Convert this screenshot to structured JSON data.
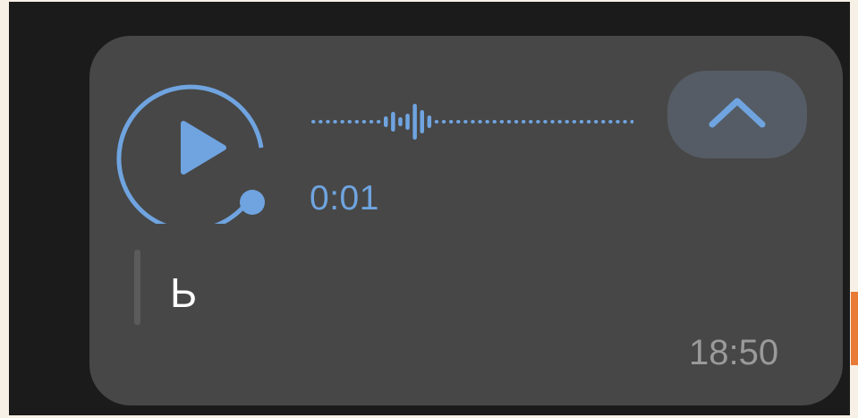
{
  "voice_message": {
    "duration": "0:01",
    "transcript": "Ь",
    "timestamp": "18:50",
    "state": "paused"
  },
  "icons": {
    "play": "play-icon",
    "collapse": "chevron-up-icon",
    "progress": "progress-dot-icon"
  },
  "colors": {
    "accent": "#6fa4e0",
    "bubble": "#474747",
    "background": "#1b1b1b",
    "collapse_button": "#555c65",
    "timestamp": "#9a9a9a"
  }
}
